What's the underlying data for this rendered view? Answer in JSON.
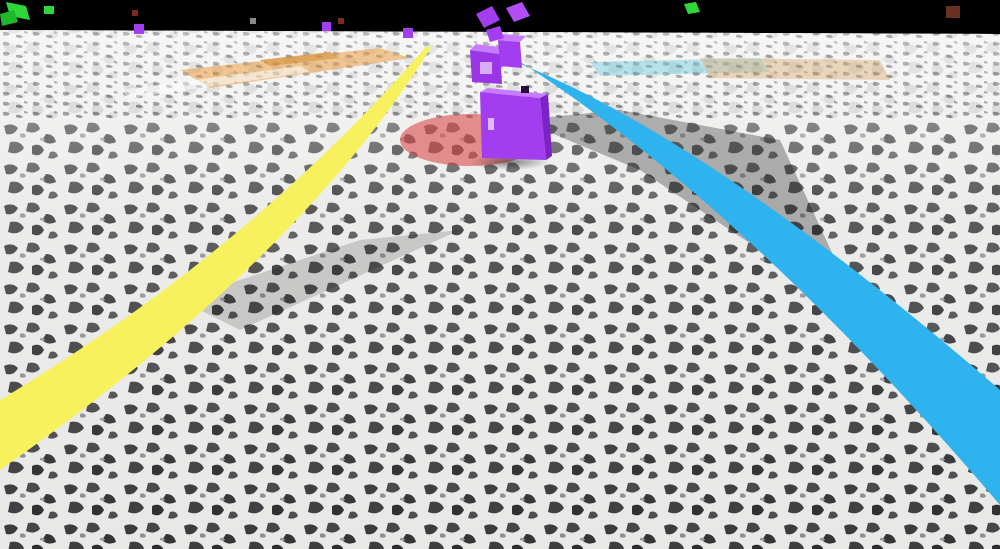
{
  "scene": {
    "sky_color": "#000000",
    "ground_light": "#e9eae8",
    "ground_dark": "#2c2c2e",
    "lane_left_color": "#f6f15c",
    "lane_right_color": "#2fb3ee",
    "cube_color": "#a23df0",
    "cube_dark": "#7d22c8",
    "cube_light": "#c77bff",
    "debris_green": "#2fd83a",
    "floor_red": "#d83a3a",
    "floor_orange": "#e89a3a",
    "floor_cyan": "#55c6d8"
  }
}
